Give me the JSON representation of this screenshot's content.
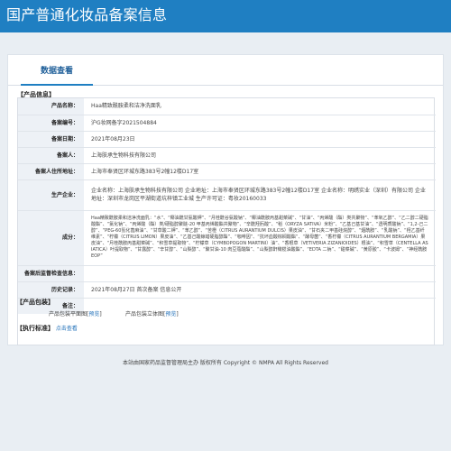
{
  "header": {
    "title": "国产普通化妆品备案信息"
  },
  "tabs": {
    "active_label": "数据查看"
  },
  "product_info": {
    "section_title": "【产品信息】",
    "rows": [
      {
        "label": "产品名称：",
        "value": "Haa精致酰胺柔和洁净洗面乳"
      },
      {
        "label": "备案编号：",
        "value": "沪G妆网备字2021504884"
      },
      {
        "label": "备案日期：",
        "value": "2021年08月23日"
      },
      {
        "label": "备案人：",
        "value": "上海肤承生物科技有限公司"
      },
      {
        "label": "备案人住所地址：",
        "value": "上海市奉贤区环城东路383号2幢12楼D17室"
      },
      {
        "label": "生产企业：",
        "value": "企业名称：上海肤承生物科技有限公司 企业地址：上海市奉贤区环城东路383号2幢12楼D17室 企业名称：明绣实业（深圳）有限公司 企业地址：深圳市龙岗区平湖街道坑梓镇工业城 生产许可证：粤妆20160033"
      },
      {
        "label": "成分：",
        "value": "Haa精致酰胺柔和洁净洗面乳：“水”、“椰油酰甘氨酸钾”、“月桂酰谷氨酸钠”、“椰油酰胺丙基甜菜碱”、“甘油”、“丙烯酸（酯）类共聚物”、“苯氧乙醇”、“乙二醇二硬脂酸酯”、“氯化钠”、“丙烯酸（酯）类/硬脂醇聚醚-20 甲基丙烯酸酯共聚物”、“辛酰羟肟酸”、“稻（ORYZA SATIVA）米粉”、“乙基己基甘油”、“透明质酸钠”、“1,2-己二醇”、“PEG-60氢化蓖麻油”、“甘草酸二钾”、“苯乙醇”、“苦橙（CITRUS AURANTIUM DULCIS）果皮油”、“甘石夹二甲基硅烷醇”、“烟酰胺”、“乳酸钠”、“羟乙基纤维素”、“柠檬（CITRUS LIMON）果皮油”、“乙基己酸鲸蜡硬脂醇酯”、“咖啡因”、“抗坏血酸棕榈酸酯”、“酵母菌”、“香柠檬（CITRUS AURANTIUM BERGAMIA）果皮油”、“月桂酰胺丙基甜菜碱”、“积雪草提取物”、“柠檬草（CYMBOPOGON MARTINI）油”、“香根草（VETIVERIA ZIZANIOIDES）根油”、“积雪草（CENTELLA ASIATICA）叶提取物”、“甘露醇”、“辛甘醇”、“山梨醇”、“聚甘油-10 肉豆蔻酸酯”、“山梨醇酐橄榄油酸酯”、“EDTA 二钠”、“甜菜碱”、“黄原胶”、“卡波姆”、“神经酰胺 EOP”"
      },
      {
        "label": "备案后监督检查信息：",
        "value": ""
      },
      {
        "label": "历史记录：",
        "value": "2021年08月27日 首次备案 信息公开"
      },
      {
        "label": "备注：",
        "value": ""
      }
    ]
  },
  "package_info": {
    "section_title": "【产品包装】",
    "flat_label": "产品包装平面图",
    "flat_link": "预览",
    "solid_label": "产品包装立体图",
    "solid_link": "预览"
  },
  "standard_info": {
    "section_title": "【执行标准】",
    "link": "点击查看"
  },
  "footer": {
    "text": "本站由国家药品监督管理局主办 版权所有 Copyright © NMPA All Rights Reserved"
  }
}
